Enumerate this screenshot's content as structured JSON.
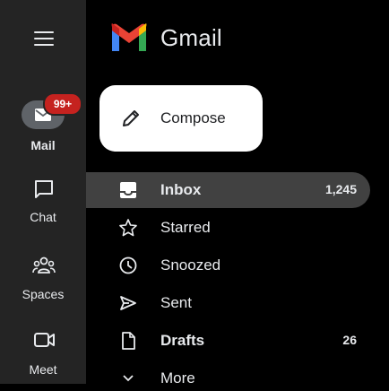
{
  "app": {
    "brand": "Gmail",
    "colors": {
      "rail_bg": "#242424",
      "active_item": "#414141",
      "compose_bg": "#ffffff",
      "badge": "#c5221f"
    }
  },
  "rail": {
    "mail_badge": "99+",
    "items": [
      {
        "label": "Mail",
        "icon": "mail-icon"
      },
      {
        "label": "Chat",
        "icon": "chat-icon"
      },
      {
        "label": "Spaces",
        "icon": "spaces-icon"
      },
      {
        "label": "Meet",
        "icon": "meet-icon"
      }
    ]
  },
  "compose": {
    "label": "Compose"
  },
  "nav": {
    "inbox": {
      "label": "Inbox",
      "count": "1,245"
    },
    "starred": {
      "label": "Starred"
    },
    "snoozed": {
      "label": "Snoozed"
    },
    "sent": {
      "label": "Sent"
    },
    "drafts": {
      "label": "Drafts",
      "count": "26"
    },
    "more": {
      "label": "More"
    }
  }
}
